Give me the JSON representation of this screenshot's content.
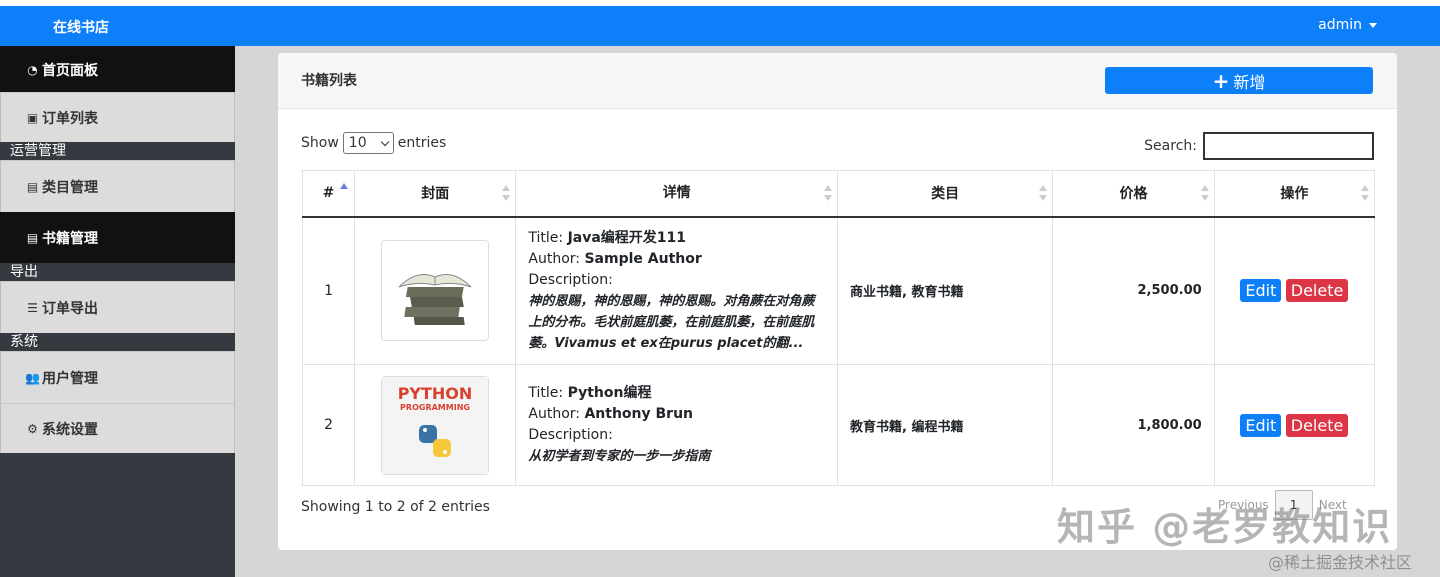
{
  "navbar": {
    "brand": "在线书店",
    "user": "admin"
  },
  "sidebar": {
    "items": [
      {
        "label": "首页面板",
        "icon": "dashboard-icon"
      },
      {
        "label": "订单列表",
        "icon": "clipboard-icon"
      },
      {
        "header": "运营管理"
      },
      {
        "label": "类目管理",
        "icon": "list-alt-icon"
      },
      {
        "label": "书籍管理",
        "icon": "book-icon"
      },
      {
        "header": "导出"
      },
      {
        "label": "订单导出",
        "icon": "list-icon"
      },
      {
        "header": "系统"
      },
      {
        "label": "用户管理",
        "icon": "users-icon"
      },
      {
        "label": "系统设置",
        "icon": "cogs-icon"
      }
    ],
    "active": "书籍管理"
  },
  "card": {
    "title": "书籍列表",
    "add_label": "新增"
  },
  "table_controls": {
    "show_prefix": "Show",
    "entries_value": "10",
    "show_suffix": "entries",
    "search_label": "Search:"
  },
  "table": {
    "headers": [
      "#",
      "封面",
      "详情",
      "类目",
      "价格",
      "操作"
    ],
    "rows": [
      {
        "num": "1",
        "title_prefix": "Title:",
        "title": "Java编程开发111",
        "author_prefix": "Author:",
        "author": "Sample Author",
        "desc_prefix": "Description:",
        "description": "神的恩赐，神的恩赐，神的恩赐。对角蕨在对角蕨上的分布。毛状前庭肌萎，在前庭肌萎，在前庭肌萎。Vivamus et ex在purus placet的翻...",
        "category": "商业书籍, 教育书籍",
        "price": "2,500.00",
        "edit": "Edit",
        "delete": "Delete"
      },
      {
        "num": "2",
        "title_prefix": "Title:",
        "title": "Python编程",
        "author_prefix": "Author:",
        "author": "Anthony Brun",
        "desc_prefix": "Description:",
        "description": "从初学者到专家的一步一步指南",
        "category": "教育书籍, 编程书籍",
        "price": "1,800.00",
        "edit": "Edit",
        "delete": "Delete",
        "cover_text": [
          "PYTHON",
          "PROGRAMMING"
        ]
      }
    ]
  },
  "footer": {
    "info": "Showing 1 to 2 of 2 entries",
    "prev": "Previous",
    "page": "1",
    "next": "Next"
  },
  "watermark": {
    "main": "知乎 @老罗教知识",
    "sub": "@稀土掘金技术社区"
  },
  "colors": {
    "primary": "#0d7ff8",
    "danger": "#dc3545",
    "sidebar_dark": "#343a40"
  }
}
